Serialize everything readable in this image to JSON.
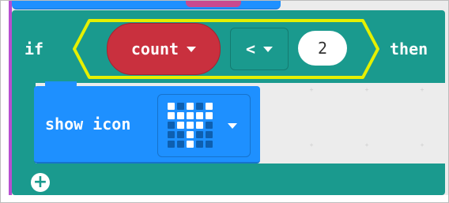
{
  "if_block": {
    "if_label": "if",
    "then_label": "then",
    "condition": {
      "variable": "count",
      "operator": "<",
      "value": "2"
    }
  },
  "show_icon_block": {
    "label": "show icon",
    "icon": "sword",
    "grid": [
      [
        1,
        0,
        1,
        0,
        1
      ],
      [
        1,
        1,
        1,
        1,
        1
      ],
      [
        0,
        1,
        1,
        1,
        0
      ],
      [
        0,
        0,
        1,
        0,
        0
      ],
      [
        0,
        0,
        1,
        0,
        0
      ]
    ]
  },
  "add_button": {
    "symbol": "+"
  },
  "colors": {
    "if_block": "#1a9a8e",
    "variable_pill": "#c9303e",
    "basic_block": "#1e90ff",
    "highlight": "#e5f000",
    "grid_on": "#ffffff",
    "grid_off": "#0d5fb0"
  }
}
